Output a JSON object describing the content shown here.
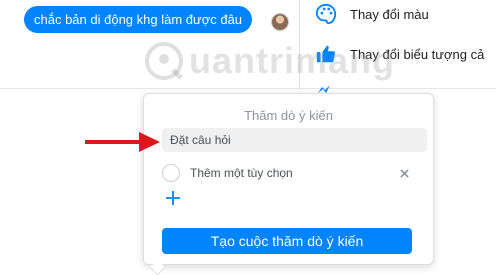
{
  "chat": {
    "message": "chắc bản di động khg làm được đâu"
  },
  "panel": {
    "change_color": "Thay đổi màu",
    "change_emoji": "Thay đổi biểu tượng cả"
  },
  "watermark": {
    "text": "uantrimang"
  },
  "poll": {
    "title": "Thăm dò ý kiến",
    "question_placeholder": "Đặt câu hỏi",
    "option_placeholder": "Thêm một tùy chọn",
    "create_label": "Tạo cuộc thăm dò ý kiến"
  },
  "colors": {
    "accent": "#0084ff",
    "annotation_arrow": "#e0161d",
    "field_bg": "#f0f0f0"
  },
  "icons": {
    "palette": "palette-icon",
    "thumbs_up": "thumbs-up-icon",
    "add": "plus-icon",
    "remove": "close-icon",
    "avatar": "avatar"
  }
}
